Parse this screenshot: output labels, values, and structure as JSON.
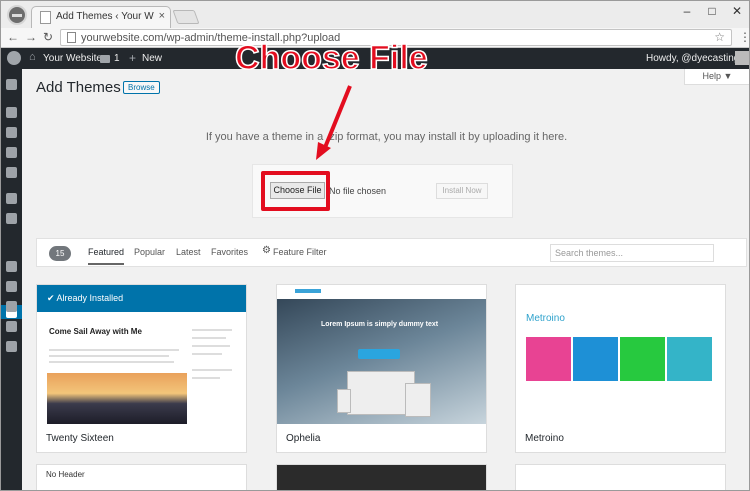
{
  "browser": {
    "tab_title": "Add Themes ‹ Your Website",
    "tab_close": "×",
    "url": "yourwebsite.com/wp-admin/theme-install.php?upload",
    "window_controls": {
      "minimize": "–",
      "maximize": "□",
      "close": "✕"
    },
    "nav": {
      "back": "←",
      "forward": "→",
      "reload": "↻",
      "star": "☆",
      "menu": "⋮"
    }
  },
  "adminbar": {
    "site_name": "Your Website",
    "comment_count": "1",
    "new_label": "New",
    "plus": "+",
    "home": "⌂",
    "howdy": "Howdy, @dyecasting"
  },
  "page": {
    "title": "Add Themes",
    "browse_label": "Browse",
    "help_label": "Help ▼",
    "upload_text": "If you have a theme in a .zip format, you may install it by uploading it here.",
    "choose_file_label": "Choose File",
    "no_file_text": "No file chosen",
    "install_label": "Install Now",
    "annotation": "Choose File"
  },
  "filters": {
    "count": "15",
    "tabs": [
      "Featured",
      "Popular",
      "Latest",
      "Favorites"
    ],
    "feature_filter": "Feature Filter",
    "gear": "⚙",
    "search_placeholder": "Search themes..."
  },
  "themes": [
    {
      "name": "Twenty Sixteen",
      "badge": "✔ Already Installed",
      "preview_title": "Come Sail Away with Me"
    },
    {
      "name": "Ophelia",
      "preview_title": "Lorem Ipsum is simply dummy text"
    },
    {
      "name": "Metroino",
      "preview_title": "Metroino"
    }
  ],
  "peek": [
    "No Header",
    "",
    ""
  ],
  "colors": {
    "accent": "#0073aa",
    "annotation": "#e30d1f",
    "adminbar": "#23282d"
  }
}
